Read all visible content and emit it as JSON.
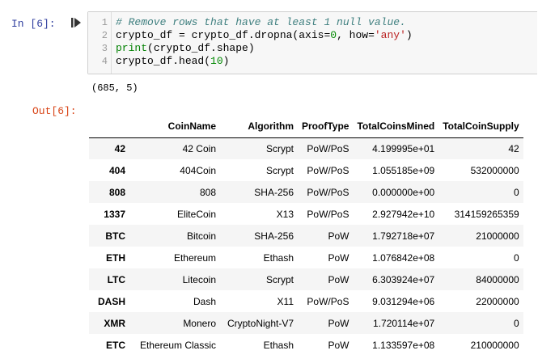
{
  "prompts": {
    "in_label": "In [6]:",
    "out_label": "Out[6]:"
  },
  "code": {
    "line_numbers": [
      "1",
      "2",
      "3",
      "4"
    ],
    "line1_comment": "# Remove rows that have at least 1 null value.",
    "line2_pre": "crypto_df = crypto_df.dropna(axis=",
    "line2_num": "0",
    "line2_mid": ", how=",
    "line2_str": "'any'",
    "line2_post": ")",
    "line3_builtin": "print",
    "line3_rest": "(crypto_df.shape)",
    "line4_pre": "crypto_df.head(",
    "line4_num": "10",
    "line4_post": ")"
  },
  "stdout": "(685, 5)",
  "table": {
    "columns": [
      "",
      "CoinName",
      "Algorithm",
      "ProofType",
      "TotalCoinsMined",
      "TotalCoinSupply"
    ],
    "rows": [
      {
        "index": "42",
        "cells": [
          "42 Coin",
          "Scrypt",
          "PoW/PoS",
          "4.199995e+01",
          "42"
        ]
      },
      {
        "index": "404",
        "cells": [
          "404Coin",
          "Scrypt",
          "PoW/PoS",
          "1.055185e+09",
          "532000000"
        ]
      },
      {
        "index": "808",
        "cells": [
          "808",
          "SHA-256",
          "PoW/PoS",
          "0.000000e+00",
          "0"
        ]
      },
      {
        "index": "1337",
        "cells": [
          "EliteCoin",
          "X13",
          "PoW/PoS",
          "2.927942e+10",
          "314159265359"
        ]
      },
      {
        "index": "BTC",
        "cells": [
          "Bitcoin",
          "SHA-256",
          "PoW",
          "1.792718e+07",
          "21000000"
        ]
      },
      {
        "index": "ETH",
        "cells": [
          "Ethereum",
          "Ethash",
          "PoW",
          "1.076842e+08",
          "0"
        ]
      },
      {
        "index": "LTC",
        "cells": [
          "Litecoin",
          "Scrypt",
          "PoW",
          "6.303924e+07",
          "84000000"
        ]
      },
      {
        "index": "DASH",
        "cells": [
          "Dash",
          "X11",
          "PoW/PoS",
          "9.031294e+06",
          "22000000"
        ]
      },
      {
        "index": "XMR",
        "cells": [
          "Monero",
          "CryptoNight-V7",
          "PoW",
          "1.720114e+07",
          "0"
        ]
      },
      {
        "index": "ETC",
        "cells": [
          "Ethereum Classic",
          "Ethash",
          "PoW",
          "1.133597e+08",
          "210000000"
        ]
      }
    ]
  }
}
